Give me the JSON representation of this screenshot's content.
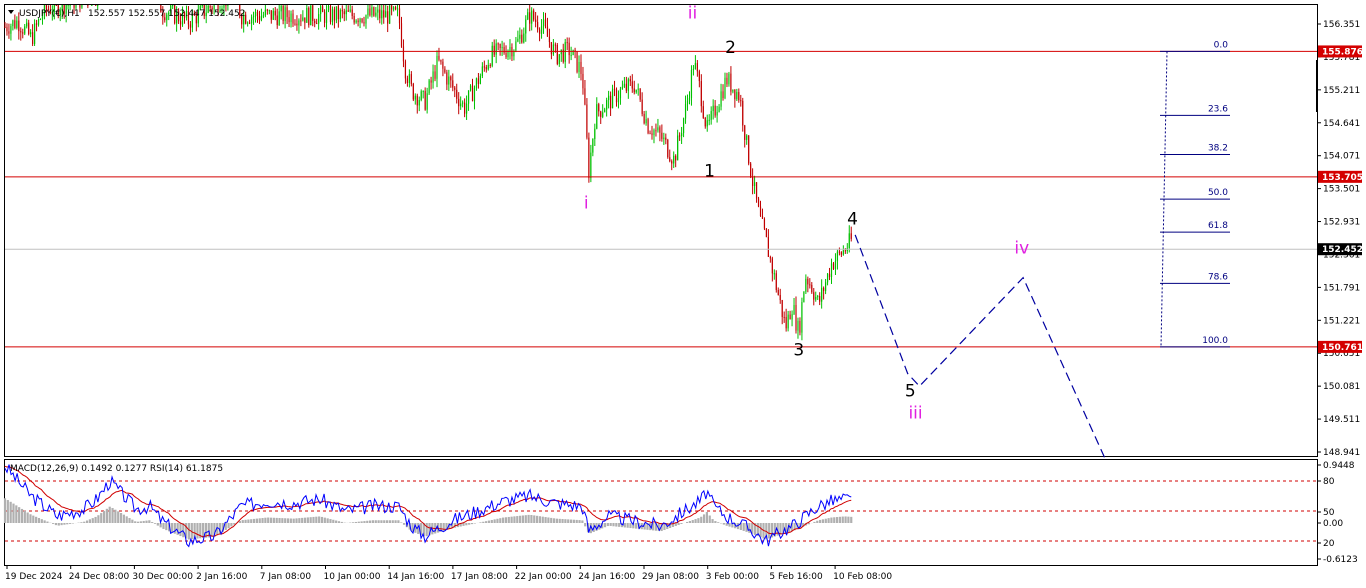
{
  "header": {
    "symbol": "USDJPY(€),H1",
    "ohlc": "152.557 152.557 152.447 152.452",
    "indicator": "MACD(12,26,9) 0.1492 0.1277  RSI(14) 61.1875"
  },
  "colors": {
    "up_candle": "#00c000",
    "down_candle": "#c00000",
    "resistance_line": "#d40000",
    "current_price_tag": "#000000",
    "fib": "#000080",
    "projection": "#0000a0",
    "wave_black": "#000000",
    "wave_magenta": "#e020e0",
    "macd_hist": "#b0b0b0",
    "rsi_line": "#0000ff",
    "signal_line": "#d00000"
  },
  "price_axis": {
    "ticks": [
      "156.351",
      "155.781",
      "155.211",
      "154.641",
      "154.071",
      "153.501",
      "152.931",
      "152.361",
      "151.791",
      "151.221",
      "150.651",
      "150.081",
      "149.511",
      "148.941"
    ],
    "min": 148.941,
    "max": 156.351
  },
  "sub_axis": {
    "ticks": [
      "0.9448",
      "80",
      "50",
      "0.00",
      "20",
      "-0.6123"
    ]
  },
  "time_axis": {
    "labels": [
      "19 Dec 2024",
      "24 Dec 08:00",
      "30 Dec 00:00",
      "2 Jan 16:00",
      "7 Jan 08:00",
      "10 Jan 00:00",
      "14 Jan 16:00",
      "17 Jan 08:00",
      "22 Jan 00:00",
      "24 Jan 16:00",
      "29 Jan 08:00",
      "3 Feb 00:00",
      "5 Feb 16:00",
      "10 Feb 08:00"
    ]
  },
  "levels": {
    "lines": [
      {
        "price": 155.876,
        "label": "155.876"
      },
      {
        "price": 153.705,
        "label": "153.705"
      },
      {
        "price": 150.761,
        "label": "150.761"
      }
    ],
    "current": {
      "price": 152.452,
      "label": "152.452"
    }
  },
  "fib": {
    "levels": [
      {
        "label": "0.0",
        "price": 155.876
      },
      {
        "label": "23.6",
        "price": 154.768
      },
      {
        "label": "38.2",
        "price": 154.091
      },
      {
        "label": "50.0",
        "price": 153.318
      },
      {
        "label": "61.8",
        "price": 152.748
      },
      {
        "label": "78.6",
        "price": 151.86
      },
      {
        "label": "100.0",
        "price": 150.761
      }
    ]
  },
  "waves": [
    {
      "label": "ii",
      "style": "magenta",
      "price": 156.45,
      "t": 0.524
    },
    {
      "label": "i",
      "style": "magenta",
      "price": 153.16,
      "t": 0.443
    },
    {
      "label": "2",
      "style": "black",
      "price": 155.85,
      "t": 0.553
    },
    {
      "label": "1",
      "style": "black",
      "price": 153.71,
      "t": 0.537
    },
    {
      "label": "4",
      "style": "black",
      "price": 152.88,
      "t": 0.646
    },
    {
      "label": "3",
      "style": "black",
      "price": 150.61,
      "t": 0.605
    },
    {
      "label": "5",
      "style": "black",
      "price": 149.9,
      "t": 0.69
    },
    {
      "label": "iii",
      "style": "magenta",
      "price": 149.52,
      "t": 0.694
    },
    {
      "label": "iv",
      "style": "magenta",
      "price": 152.38,
      "t": 0.775
    }
  ],
  "projection": [
    {
      "t": 0.648,
      "price": 152.7
    },
    {
      "t": 0.688,
      "price": 150.3
    },
    {
      "t": 0.697,
      "price": 150.08
    },
    {
      "t": 0.776,
      "price": 151.96
    },
    {
      "t": 0.838,
      "price": 148.85
    }
  ],
  "chart_data": {
    "type": "line",
    "title": "",
    "series": [
      {
        "name": "USDJPY(€),H1",
        "x": [
          0.0,
          0.01,
          0.02,
          0.03,
          0.06,
          0.1,
          0.11,
          0.12,
          0.14,
          0.16,
          0.175,
          0.18,
          0.3,
          0.305,
          0.31,
          0.32,
          0.33,
          0.35,
          0.37,
          0.39,
          0.4,
          0.41,
          0.42,
          0.43,
          0.44,
          0.445,
          0.45,
          0.47,
          0.48,
          0.49,
          0.5,
          0.51,
          0.52,
          0.525,
          0.53,
          0.535,
          0.54,
          0.55,
          0.56,
          0.565,
          0.57,
          0.575,
          0.58,
          0.59,
          0.595,
          0.6,
          0.605,
          0.61,
          0.615,
          0.62,
          0.63,
          0.64,
          0.645
        ],
        "values": [
          156.3,
          156.4,
          156.1,
          156.6,
          156.8,
          157.3,
          157.0,
          156.6,
          156.4,
          156.7,
          156.9,
          156.5,
          156.5,
          155.6,
          155.2,
          155.0,
          155.7,
          154.9,
          155.8,
          156.0,
          156.5,
          156.3,
          155.8,
          155.9,
          155.5,
          153.8,
          154.8,
          155.2,
          155.3,
          154.6,
          154.4,
          154.0,
          155.0,
          155.7,
          155.2,
          154.5,
          154.8,
          155.4,
          155.1,
          154.3,
          153.6,
          153.0,
          152.6,
          151.6,
          151.1,
          151.5,
          151.0,
          152.0,
          151.8,
          151.5,
          152.2,
          152.45,
          152.6
        ]
      },
      {
        "name": "RSI(14)",
        "x": [
          0.0,
          0.02,
          0.04,
          0.06,
          0.07,
          0.08,
          0.1,
          0.11,
          0.12,
          0.14,
          0.16,
          0.18,
          0.2,
          0.22,
          0.24,
          0.26,
          0.28,
          0.3,
          0.31,
          0.32,
          0.34,
          0.36,
          0.38,
          0.4,
          0.42,
          0.44,
          0.445,
          0.46,
          0.48,
          0.5,
          0.52,
          0.53,
          0.535,
          0.54,
          0.55,
          0.56,
          0.57,
          0.58,
          0.59,
          0.6,
          0.61,
          0.62,
          0.63,
          0.64,
          0.645
        ],
        "values": [
          95,
          65,
          45,
          52,
          62,
          80,
          52,
          55,
          40,
          20,
          25,
          55,
          60,
          58,
          62,
          50,
          55,
          55,
          35,
          25,
          40,
          50,
          60,
          65,
          58,
          55,
          30,
          45,
          40,
          35,
          52,
          60,
          70,
          55,
          45,
          38,
          30,
          20,
          28,
          35,
          45,
          55,
          60,
          62,
          61.1875
        ]
      }
    ],
    "ylabel": "",
    "xlabel": "",
    "ylim": [
      148.941,
      156.351
    ]
  }
}
